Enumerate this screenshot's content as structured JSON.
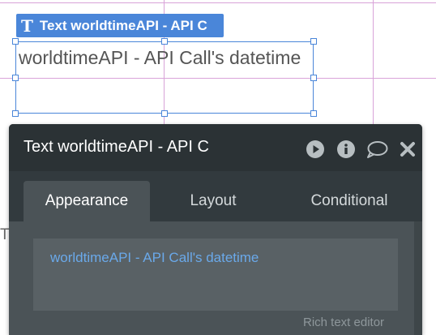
{
  "canvas": {
    "element_tag": {
      "icon": "text-element-icon",
      "label": "Text worldtimeAPI - API C"
    },
    "selected_element_text": "worldtimeAPI - API Call's datetime",
    "partial_text": "Ti"
  },
  "property_editor": {
    "title": "Text worldtimeAPI - API C",
    "header_icons": [
      "preview-play-icon",
      "info-icon",
      "comment-icon",
      "close-icon"
    ],
    "tabs": [
      {
        "label": "Appearance",
        "active": true
      },
      {
        "label": "Layout",
        "active": false
      },
      {
        "label": "Conditional",
        "active": false
      }
    ],
    "content": {
      "dynamic_text": "worldtimeAPI - API Call's datetime",
      "rich_text_editor_link": "Rich text editor"
    }
  },
  "colors": {
    "selection_blue": "#4a86d9",
    "panel_dark": "#2b3235",
    "panel_body": "#4b5357",
    "dynamic_expression": "#6aa9ea",
    "guide_line": "#d9a3d9"
  }
}
